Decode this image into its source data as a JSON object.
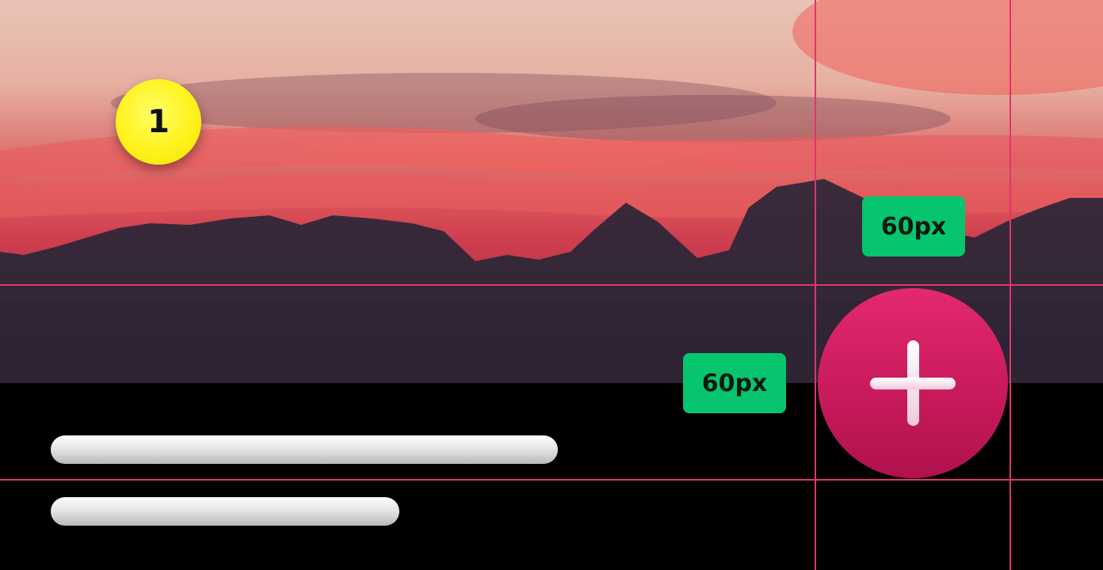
{
  "step_badge": {
    "number": "1",
    "color": "#fff21c"
  },
  "measurements": {
    "top_label": "60px",
    "left_label": "60px",
    "label_color": "#06c56e"
  },
  "fab": {
    "icon": "plus-icon",
    "color": "#c81a5c"
  },
  "guides": {
    "color": "#e0356b"
  },
  "placeholders": {
    "count": 2
  }
}
